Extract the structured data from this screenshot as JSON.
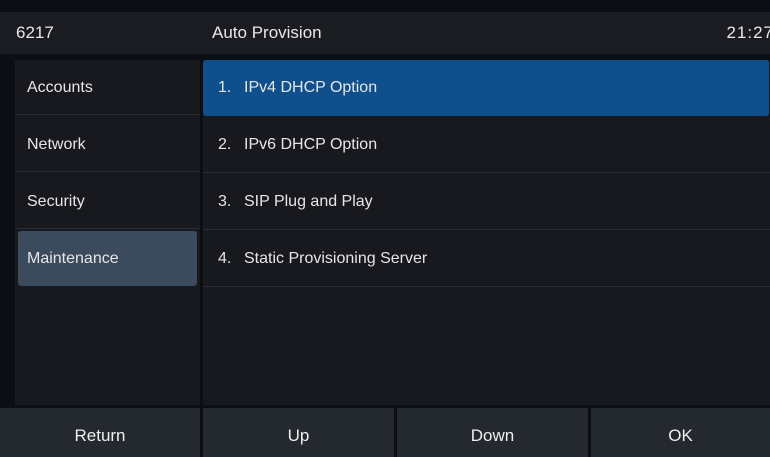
{
  "status_bar": {
    "extension": "6217",
    "title": "Auto Provision",
    "time": "21:27"
  },
  "sidebar": {
    "items": [
      {
        "label": "Accounts"
      },
      {
        "label": "Network"
      },
      {
        "label": "Security"
      },
      {
        "label": "Maintenance",
        "active": true
      }
    ]
  },
  "main": {
    "options": [
      {
        "num": "1.",
        "label": "IPv4 DHCP Option",
        "selected": true
      },
      {
        "num": "2.",
        "label": "IPv6 DHCP Option"
      },
      {
        "num": "3.",
        "label": "SIP Plug and Play"
      },
      {
        "num": "4.",
        "label": "Static Provisioning Server"
      }
    ]
  },
  "softkeys": {
    "return": "Return",
    "up": "Up",
    "down": "Down",
    "ok": "OK"
  },
  "colors": {
    "selected_row": "#0e4f8c",
    "active_nav": "#3b4a5c",
    "panel_bg": "#17191e",
    "screen_bg": "#0b0f14",
    "softkey_bg": "#24282f"
  }
}
